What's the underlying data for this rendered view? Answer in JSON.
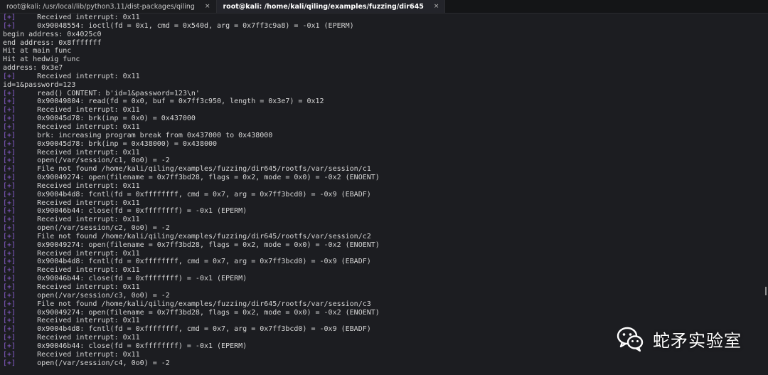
{
  "tabs": [
    {
      "label": "root@kali: /usr/local/lib/python3.11/dist-packages/qiling",
      "close": "×",
      "active": false
    },
    {
      "label": "root@kali: /home/kali/qiling/examples/fuzzing/dir645",
      "close": "×",
      "active": true
    }
  ],
  "terminal": {
    "colors": {
      "tag": "#8b5fd0",
      "text": "#d6d6d6",
      "background": "#1c1d21"
    },
    "lines": [
      {
        "tag": "[+]",
        "text": "     Received interrupt: 0x11"
      },
      {
        "tag": "[+]",
        "text": "     0x90048554: ioctl(fd = 0x1, cmd = 0x540d, arg = 0x7ff3c9a8) = -0x1 (EPERM)"
      },
      {
        "tag": "",
        "text": "begin address: 0x4025c0"
      },
      {
        "tag": "",
        "text": "end address: 0x8fffffff"
      },
      {
        "tag": "",
        "text": "Hit at main func"
      },
      {
        "tag": "",
        "text": "Hit at hedwig func"
      },
      {
        "tag": "",
        "text": "address: 0x3e7"
      },
      {
        "tag": "[+]",
        "text": "     Received interrupt: 0x11"
      },
      {
        "tag": "",
        "text": "id=1&password=123"
      },
      {
        "tag": "[+]",
        "text": "     read() CONTENT: b'id=1&password=123\\n'"
      },
      {
        "tag": "[+]",
        "text": "     0x90049804: read(fd = 0x0, buf = 0x7ff3c950, length = 0x3e7) = 0x12"
      },
      {
        "tag": "[+]",
        "text": "     Received interrupt: 0x11"
      },
      {
        "tag": "[+]",
        "text": "     0x90045d78: brk(inp = 0x0) = 0x437000"
      },
      {
        "tag": "[+]",
        "text": "     Received interrupt: 0x11"
      },
      {
        "tag": "[+]",
        "text": "     brk: increasing program break from 0x437000 to 0x438000"
      },
      {
        "tag": "[+]",
        "text": "     0x90045d78: brk(inp = 0x438000) = 0x438000"
      },
      {
        "tag": "[+]",
        "text": "     Received interrupt: 0x11"
      },
      {
        "tag": "[+]",
        "text": "     open(/var/session/c1, 0o0) = -2"
      },
      {
        "tag": "[+]",
        "text": "     File not found /home/kali/qiling/examples/fuzzing/dir645/rootfs/var/session/c1"
      },
      {
        "tag": "[+]",
        "text": "     0x90049274: open(filename = 0x7ff3bd28, flags = 0x2, mode = 0x0) = -0x2 (ENOENT)"
      },
      {
        "tag": "[+]",
        "text": "     Received interrupt: 0x11"
      },
      {
        "tag": "[+]",
        "text": "     0x9004b4d8: fcntl(fd = 0xffffffff, cmd = 0x7, arg = 0x7ff3bcd0) = -0x9 (EBADF)"
      },
      {
        "tag": "[+]",
        "text": "     Received interrupt: 0x11"
      },
      {
        "tag": "[+]",
        "text": "     0x90046b44: close(fd = 0xffffffff) = -0x1 (EPERM)"
      },
      {
        "tag": "[+]",
        "text": "     Received interrupt: 0x11"
      },
      {
        "tag": "[+]",
        "text": "     open(/var/session/c2, 0o0) = -2"
      },
      {
        "tag": "[+]",
        "text": "     File not found /home/kali/qiling/examples/fuzzing/dir645/rootfs/var/session/c2"
      },
      {
        "tag": "[+]",
        "text": "     0x90049274: open(filename = 0x7ff3bd28, flags = 0x2, mode = 0x0) = -0x2 (ENOENT)"
      },
      {
        "tag": "[+]",
        "text": "     Received interrupt: 0x11"
      },
      {
        "tag": "[+]",
        "text": "     0x9004b4d8: fcntl(fd = 0xffffffff, cmd = 0x7, arg = 0x7ff3bcd0) = -0x9 (EBADF)"
      },
      {
        "tag": "[+]",
        "text": "     Received interrupt: 0x11"
      },
      {
        "tag": "[+]",
        "text": "     0x90046b44: close(fd = 0xffffffff) = -0x1 (EPERM)"
      },
      {
        "tag": "[+]",
        "text": "     Received interrupt: 0x11"
      },
      {
        "tag": "[+]",
        "text": "     open(/var/session/c3, 0o0) = -2"
      },
      {
        "tag": "[+]",
        "text": "     File not found /home/kali/qiling/examples/fuzzing/dir645/rootfs/var/session/c3"
      },
      {
        "tag": "[+]",
        "text": "     0x90049274: open(filename = 0x7ff3bd28, flags = 0x2, mode = 0x0) = -0x2 (ENOENT)"
      },
      {
        "tag": "[+]",
        "text": "     Received interrupt: 0x11"
      },
      {
        "tag": "[+]",
        "text": "     0x9004b4d8: fcntl(fd = 0xffffffff, cmd = 0x7, arg = 0x7ff3bcd0) = -0x9 (EBADF)"
      },
      {
        "tag": "[+]",
        "text": "     Received interrupt: 0x11"
      },
      {
        "tag": "[+]",
        "text": "     0x90046b44: close(fd = 0xffffffff) = -0x1 (EPERM)"
      },
      {
        "tag": "[+]",
        "text": "     Received interrupt: 0x11"
      },
      {
        "tag": "[+]",
        "text": "     open(/var/session/c4, 0o0) = -2"
      }
    ]
  },
  "watermark": {
    "icon": "wechat-icon",
    "text": "蛇矛实验室"
  }
}
